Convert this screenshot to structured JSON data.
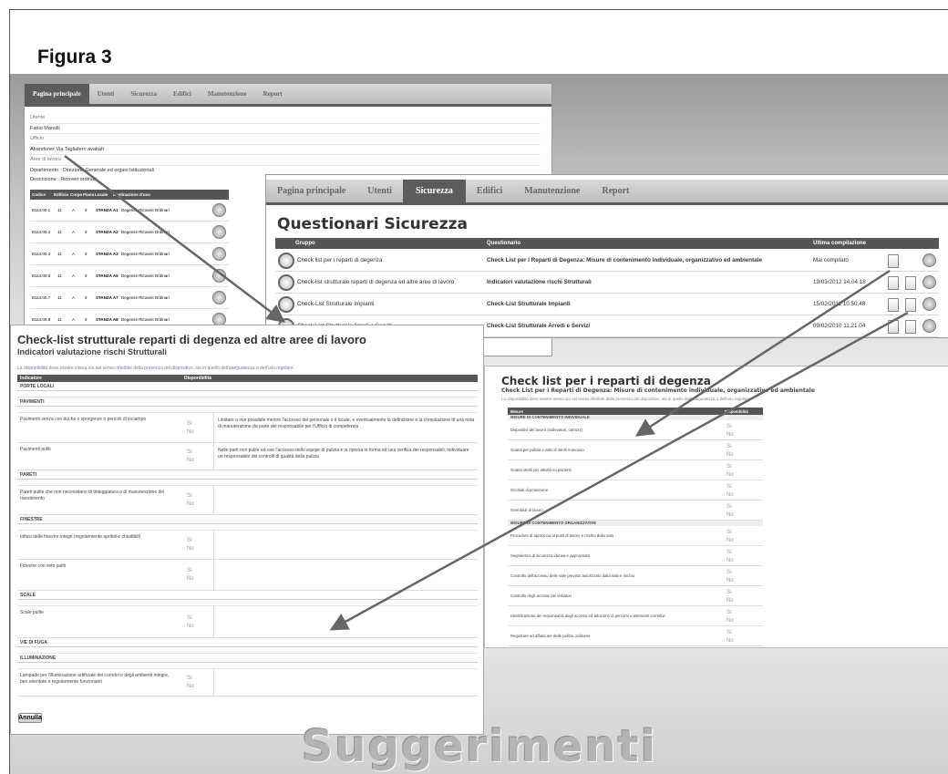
{
  "figure_title": "Figura 3",
  "footer_text": "Suggerimenti",
  "nav": {
    "home": "Pagina principale",
    "utenti": "Utenti",
    "sicurezza": "Sicurezza",
    "edifici": "Edifici",
    "manutenzione": "Manutenzione",
    "report": "Report"
  },
  "user_win": {
    "lbl_utente": "Utente",
    "val_utente": "Fabio Manolli",
    "lbl_ufficio": "Ufficio",
    "val_ufficio": "Abandoner Via Tagliaferri avabati",
    "lbl_aree": "Aree di lavoro",
    "dept": "Dipartimento : Direzione Generale ed organi istituzionali",
    "desc": "Descrizione : Ricoveri ordinari",
    "headers": [
      "Codice",
      "Edificio",
      "Corpo",
      "Piano",
      "Locale",
      "Destinazione d'uso"
    ],
    "rows": [
      {
        "code": "B114.00.1",
        "ed": "11",
        "corpo": "A",
        "piano": "3",
        "loc": "STANZA A1",
        "dest": "Degenze Ricoveri Ordinari"
      },
      {
        "code": "B114.00.2",
        "ed": "11",
        "corpo": "A",
        "piano": "3",
        "loc": "STANZA A2",
        "dest": "Degenze Ricoveri Ordinari"
      },
      {
        "code": "B114.00.3",
        "ed": "11",
        "corpo": "A",
        "piano": "3",
        "loc": "STANZA A3",
        "dest": "Degenze Ricoveri Ordinari"
      },
      {
        "code": "B114.00.5",
        "ed": "11",
        "corpo": "A",
        "piano": "3",
        "loc": "STANZA A5",
        "dest": "Degenze Ricoveri Ordinari"
      },
      {
        "code": "B114.00.7",
        "ed": "11",
        "corpo": "A",
        "piano": "3",
        "loc": "STANZA A7",
        "dest": "Degenze Ricoveri Ordinari"
      },
      {
        "code": "B114.00.8",
        "ed": "11",
        "corpo": "A",
        "piano": "3",
        "loc": "STANZA A8",
        "dest": "Degenze Ricoveri Ordinari"
      }
    ]
  },
  "quest_win": {
    "title": "Questionari Sicurezza",
    "headers": {
      "gruppo": "Gruppo",
      "questionario": "Questionario",
      "ultima": "Ultima compilazione"
    },
    "rows": [
      {
        "gruppo": "Check list per i reparti di degenza",
        "quest": "Check List per i Reparti di Degenza: Misure di contenimento individuale, organizzativo ed ambientale",
        "date": "Mai compilato"
      },
      {
        "gruppo": "Check-list strutturale reparti di degenza ed altre aree di lavoro",
        "quest": "Indicatori valutazione rischi Strutturali",
        "date": "19/03/2012 14.04.18"
      },
      {
        "gruppo": "Check-List Strutturale Impianti",
        "quest": "Check-List Strutturale Impianti",
        "date": "15/02/2011 10.50.48"
      },
      {
        "gruppo": "Check-List Strutturale Arredi e Servizi",
        "quest": "Check-List Strutturale Arredi e Servizi",
        "date": "09/02/2010 11.21.04"
      }
    ]
  },
  "struct_win": {
    "title": "Check-list strutturale reparti di degenza ed altre aree di lavoro",
    "subtitle": "Indicatori valutazione rischi Strutturali",
    "note": "La disponibilità deve essere intesa sia nel senso riferibile della presenza del dispositivo, sia in quello dell'adeguatezza o dell'uso regolare.",
    "col_indicatore": "Indicatore",
    "col_disp": "Disponibilità",
    "opt_si": "Sì",
    "opt_no": "No",
    "btn_annulla": "Annulla",
    "sections": {
      "porte": "PORTE LOCALI",
      "pavimenti": "PAVIMENTI",
      "pareti": "PARETI",
      "finestre": "FINESTRE",
      "scale": "SCALE",
      "vie_fuga": "VIE DI FUGA",
      "illuminazione": "ILLUMINAZIONE"
    },
    "items": {
      "pav1": "Pavimenti senza con buche o sporgenze o pericoli di inciampo",
      "pav1_note": "Limitare a ove possibile mentre l'accesso del personale o il locale, e eventualmente la definizione e la compilazione di una nota di manutenzione da parte del responsabile per l'Ufficio di competenza",
      "pav2": "Pavimenti puliti",
      "pav2_note": "Nelle parti non pulite ed ove l'accesso dello equipe di pulizia e la ripresa in forma ed una verifica dei responsabili, individuare un responsabile dei controlli di qualità della pulizia",
      "par1": "Pareti pulite che non necessitano di tinteggiatura o di manutenzione del rivestimento",
      "fin1": "Infissi delle finestre integri (regolarmente apribili e chiudibili)",
      "fin2": "Finestre con vetri puliti",
      "sca1": "Scale pulite",
      "ill1": "Lampade per l'illuminazione artificiale dei corridoi e degli ambienti integre, ben orientate e regolarmente funzionanti"
    }
  },
  "deg_win": {
    "title": "Check list per i reparti di degenza",
    "subtitle": "Check List per i Reparti di Degenza: Misure di contenimento individuale, organizzativo ed ambientale",
    "note": "La disponibilità deve essere intesa sia nel senso riferibile della presenza del dispositivo, sia in quello dell'adeguatezza o dell'uso regolare.",
    "col_misure": "Misure",
    "col_disp": "Disponibilità",
    "sec1": "MISURE DI CONTENIMENTO INDIVIDUALE",
    "sec2": "MISURE DI CONTENIMENTO ORGANIZZATIVE",
    "opt_si": "Sì",
    "opt_no": "No",
    "items": [
      "Dispositivi del lavoro (sollevatori, carrozz)",
      "Guanti per pulizia e articoli sterili monouso",
      "Guanti sterili per attività su pazienti",
      "Occhiali di protezione",
      "Grembiuli di lavoro",
      "Procedure di approccio ai posti di lavoro e rischio della sala",
      "Segnaletica di sicurezza idonea e appropriata",
      "Controllo dell'accesso delle sale previsto autorizzato dalla sala e rischio",
      "Controllo degli accessi dei visitatori",
      "Identificazione dei responsabili degli accessi ed adozione di percorsi e interventi correttivi",
      "Registrare ed affiancare delle pulizie ordinarie"
    ]
  }
}
